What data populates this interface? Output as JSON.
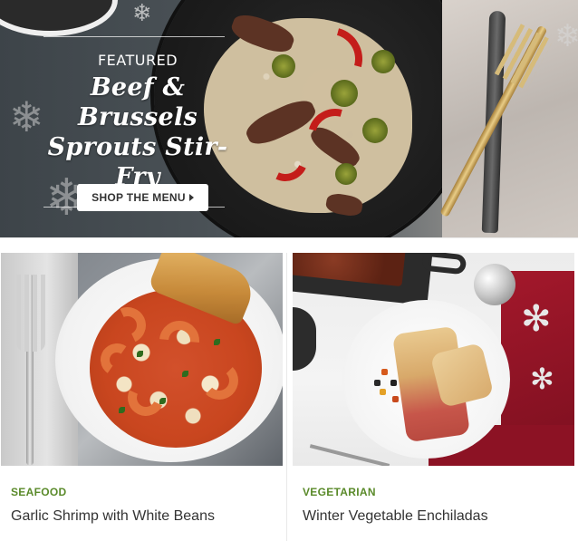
{
  "hero": {
    "eyebrow": "FEATURED",
    "title_line1": "Beef & Brussels",
    "title_line2": "Sprouts Stir-Fry",
    "cta_label": "SHOP THE MENU"
  },
  "cards": [
    {
      "category": "SEAFOOD",
      "title": "Garlic Shrimp with White Beans"
    },
    {
      "category": "VEGETARIAN",
      "title": "Winter Vegetable Enchiladas"
    }
  ],
  "colors": {
    "category_text": "#5a8a2a",
    "title_text": "#333333",
    "cta_background": "#ffffff"
  },
  "icons": {
    "cta_arrow": "triangle-right-icon",
    "decoration": "snowflake-icon"
  }
}
